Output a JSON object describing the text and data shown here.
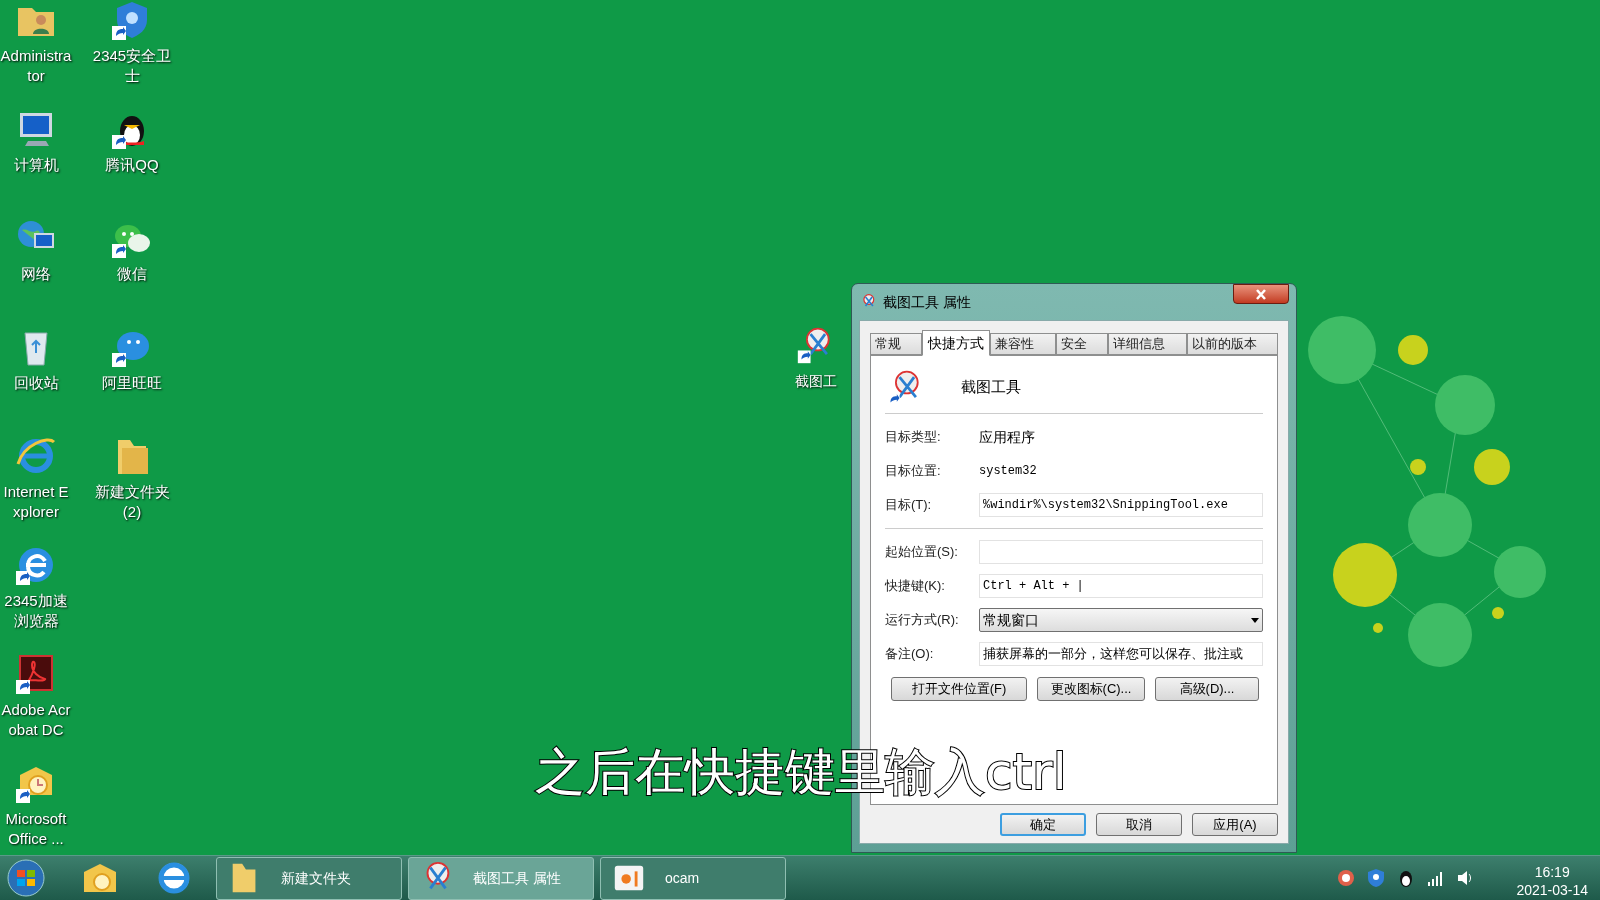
{
  "desktop_icons": [
    {
      "label": "Administrator",
      "kind": "user-folder",
      "shortcut": false
    },
    {
      "label": "计算机",
      "kind": "computer",
      "shortcut": false
    },
    {
      "label": "网络",
      "kind": "network",
      "shortcut": false
    },
    {
      "label": "回收站",
      "kind": "recycle",
      "shortcut": false
    },
    {
      "label": "Internet Explorer",
      "kind": "ie",
      "shortcut": false
    },
    {
      "label": "2345加速浏览器",
      "kind": "browser",
      "shortcut": true
    },
    {
      "label": "Adobe Acrobat DC",
      "kind": "pdf",
      "shortcut": true
    },
    {
      "label": "Microsoft Office ...",
      "kind": "office",
      "shortcut": true
    },
    {
      "label": "2345安全卫士",
      "kind": "shield",
      "shortcut": true
    },
    {
      "label": "腾讯QQ",
      "kind": "penguin",
      "shortcut": true
    },
    {
      "label": "微信",
      "kind": "chat",
      "shortcut": true
    },
    {
      "label": "阿里旺旺",
      "kind": "bubble",
      "shortcut": true
    },
    {
      "label": "新建文件夹 (2)",
      "kind": "folder",
      "shortcut": false
    }
  ],
  "partial_icon": {
    "label": "截图工"
  },
  "dialog": {
    "title": "截图工具 属性",
    "tabs": [
      {
        "label": "常规",
        "selected": false
      },
      {
        "label": "快捷方式",
        "selected": true
      },
      {
        "label": "兼容性",
        "selected": false
      },
      {
        "label": "安全",
        "selected": false
      },
      {
        "label": "详细信息",
        "selected": false
      },
      {
        "label": "以前的版本",
        "selected": false
      }
    ],
    "app_name": "截图工具",
    "rows": [
      {
        "kind": "text",
        "label": "目标类型:",
        "value": "应用程序"
      },
      {
        "kind": "mono",
        "label": "目标位置:",
        "value": "system32"
      },
      {
        "kind": "input",
        "label": "目标(T):",
        "value": "%windir%\\system32\\SnippingTool.exe"
      },
      {
        "kind": "divider"
      },
      {
        "kind": "input",
        "label": "起始位置(S):",
        "value": ""
      },
      {
        "kind": "input",
        "label": "快捷键(K):",
        "value": "Ctrl + Alt + |"
      },
      {
        "kind": "select",
        "label": "运行方式(R):",
        "value": "常规窗口"
      },
      {
        "kind": "input-cjk",
        "label": "备注(O):",
        "value": "捕获屏幕的一部分，这样您可以保存、批注或"
      }
    ],
    "actions": [
      "打开文件位置(F)",
      "更改图标(C)...",
      "高级(D)..."
    ],
    "footer": [
      {
        "label": "确定",
        "default": true
      },
      {
        "label": "取消",
        "default": false
      },
      {
        "label": "应用(A)",
        "default": false
      }
    ]
  },
  "caption": "之后在快捷键里输入ctrl",
  "taskbar": {
    "pinned": [
      {
        "kind": "start"
      },
      {
        "kind": "mail"
      },
      {
        "kind": "ie"
      }
    ],
    "windows": [
      {
        "label": "新建文件夹",
        "kind": "folder",
        "selected": false
      },
      {
        "label": "截图工具 属性",
        "kind": "scissors",
        "selected": true
      },
      {
        "label": "ocam",
        "kind": "ocam",
        "selected": false
      }
    ],
    "tray": [
      {
        "kind": "record"
      },
      {
        "kind": "shield"
      },
      {
        "kind": "penguin"
      },
      {
        "kind": "signal"
      },
      {
        "kind": "volume"
      }
    ],
    "time": "16:19",
    "date": "2021-03-14"
  }
}
